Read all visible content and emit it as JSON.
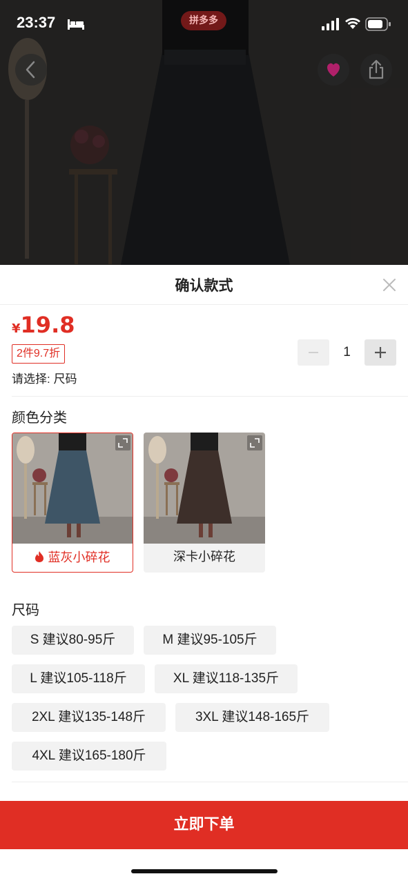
{
  "status_bar": {
    "time": "23:37"
  },
  "header_overlay": {
    "brand": "拼多多"
  },
  "sheet": {
    "title": "确认款式"
  },
  "price": {
    "currency": "¥",
    "amount": "19.8"
  },
  "promo": "2件9.7折",
  "select_hint": "请选择: 尺码",
  "quantity": {
    "value": "1",
    "minus": "−",
    "plus": "+"
  },
  "color_section": {
    "label": "颜色分类",
    "options": [
      {
        "name": "蓝灰小碎花",
        "selected": true,
        "hot": true
      },
      {
        "name": "深卡小碎花",
        "selected": false,
        "hot": false
      }
    ]
  },
  "size_section": {
    "label": "尺码",
    "options": [
      "S 建议80-95斤",
      "M 建议95-105斤",
      "L 建议105-118斤",
      "XL 建议118-135斤",
      "2XL 建议135-148斤",
      "3XL 建议148-165斤",
      "4XL 建议165-180斤"
    ]
  },
  "buy_button": "立即下单",
  "colors": {
    "accent": "#e02e24",
    "chip_bg": "#f2f2f2"
  }
}
